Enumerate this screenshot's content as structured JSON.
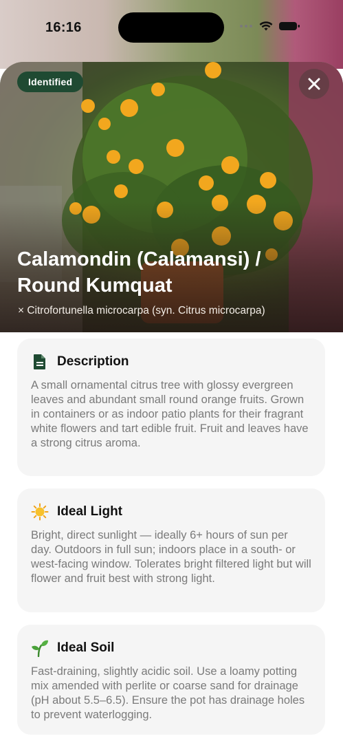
{
  "status_bar": {
    "time": "16:16"
  },
  "hero": {
    "badge": "Identified",
    "title": "Calamondin (Calamansi) / Round Kumquat",
    "scientific_name": "× Citrofortunella microcarpa (syn. Citrus microcarpa)"
  },
  "sections": [
    {
      "icon": "document-icon",
      "title": "Description",
      "body": "A small ornamental citrus tree with glossy evergreen leaves and abundant small round orange fruits. Grown in containers or as indoor patio plants for their fragrant white flowers and tart edible fruit. Fruit and leaves have a strong citrus aroma."
    },
    {
      "icon": "sun-icon",
      "title": "Ideal Light",
      "body": "Bright, direct sunlight — ideally 6+ hours of sun per day. Outdoors in full sun; indoors place in a south- or west-facing window. Tolerates bright filtered light but will flower and fruit best with strong light."
    },
    {
      "icon": "seedling-icon",
      "title": "Ideal Soil",
      "body": "Fast-draining, slightly acidic soil. Use a loamy potting mix amended with perlite or coarse sand for drainage (pH about 5.5–6.5). Ensure the pot has drainage holes to prevent waterlogging."
    }
  ],
  "colors": {
    "badge_bg": "#1f4a32",
    "card_bg": "#f5f5f5",
    "body_text": "#7a7a7a"
  }
}
